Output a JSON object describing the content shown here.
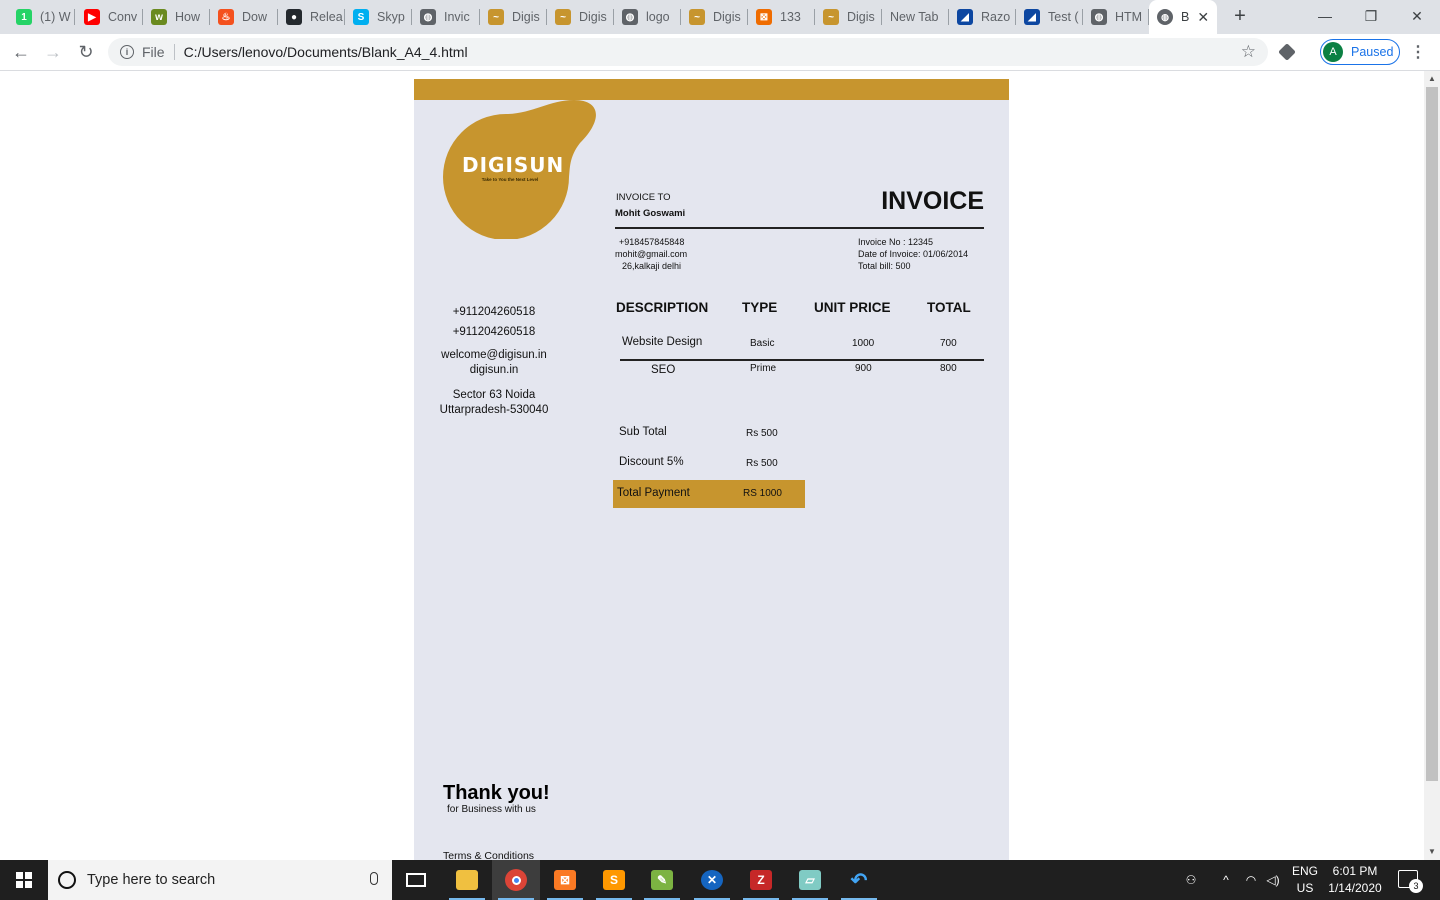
{
  "browser": {
    "tabs": [
      {
        "title": "(1) W",
        "fav_color": "#25d366",
        "fav_glyph": "1"
      },
      {
        "title": "Conv",
        "fav_color": "#ff0000",
        "fav_glyph": "▶"
      },
      {
        "title": "How",
        "fav_color": "#6a8a1f",
        "fav_glyph": "w"
      },
      {
        "title": "Dow",
        "fav_color": "#f4511e",
        "fav_glyph": "♨"
      },
      {
        "title": "Relea",
        "fav_color": "#24292e",
        "fav_glyph": "●"
      },
      {
        "title": "Skyp",
        "fav_color": "#00aff0",
        "fav_glyph": "S"
      },
      {
        "title": "Invic",
        "fav_color": "#5f6368",
        "fav_glyph": "◍"
      },
      {
        "title": "Digis",
        "fav_color": "#c7952e",
        "fav_glyph": "~"
      },
      {
        "title": "Digis",
        "fav_color": "#c7952e",
        "fav_glyph": "~"
      },
      {
        "title": "logo",
        "fav_color": "#5f6368",
        "fav_glyph": "◍"
      },
      {
        "title": "Digis",
        "fav_color": "#c7952e",
        "fav_glyph": "~"
      },
      {
        "title": "133",
        "fav_color": "#ef6c00",
        "fav_glyph": "⊠"
      },
      {
        "title": "Digis",
        "fav_color": "#c7952e",
        "fav_glyph": "~"
      },
      {
        "title": "New Tab",
        "fav_color": "",
        "fav_glyph": ""
      },
      {
        "title": "Razo",
        "fav_color": "#0d47a1",
        "fav_glyph": "◢"
      },
      {
        "title": "Test (",
        "fav_color": "#0d47a1",
        "fav_glyph": "◢"
      },
      {
        "title": "HTM",
        "fav_color": "#5f6368",
        "fav_glyph": "◍"
      }
    ],
    "active_tab": {
      "title": "B",
      "fav_color": "#5f6368",
      "fav_glyph": "◍"
    },
    "address_scheme": "File",
    "url": "C:/Users/lenovo/Documents/Blank_A4_4.html",
    "profile_initial": "A",
    "profile_status": "Paused"
  },
  "invoice": {
    "logo_text": "DIGISUN",
    "logo_tagline": "Take to You the Next Level",
    "invoice_to_label": "INVOICE TO",
    "customer_name": "Mohit Goswami",
    "title": "INVOICE",
    "customer_phone": "+918457845848",
    "customer_email": "mohit@gmail.com",
    "customer_address": "26,kalkaji delhi",
    "invoice_no": "Invoice No : 12345",
    "invoice_date": "Date of Invoice: 01/06/2014",
    "total_bill": "Total bill: 500",
    "company": {
      "phone1": "+911204260518",
      "phone2": "+911204260518",
      "email": "welcome@digisun.in",
      "website": "digisun.in",
      "address_line1": "Sector 63 Noida",
      "address_line2": "Uttarpradesh-530040"
    },
    "table_headers": [
      "DESCRIPTION",
      "TYPE",
      "UNIT PRICE",
      "TOTAL"
    ],
    "rows": [
      {
        "description": "Website Design",
        "type": "Basic",
        "unit_price": "1000",
        "total": "700"
      },
      {
        "description": "SEO",
        "type": "Prime",
        "unit_price": "900",
        "total": "800"
      }
    ],
    "sub_total_label": "Sub Total",
    "sub_total_value": "Rs 500",
    "discount_label": "Discount 5%",
    "discount_value": "Rs 500",
    "total_payment_label": "Total Payment",
    "total_payment_value": "RS 1000",
    "thank_you": "Thank you!",
    "thank_sub": "for Business with us",
    "terms": "Terms & Conditions",
    "accent_color": "#c7952e",
    "page_bg": "#e4e6ef"
  },
  "taskbar": {
    "search_placeholder": "Type here to search",
    "lang_line1": "ENG",
    "lang_line2": "US",
    "time": "6:01 PM",
    "date": "1/14/2020",
    "notification_count": "3"
  }
}
